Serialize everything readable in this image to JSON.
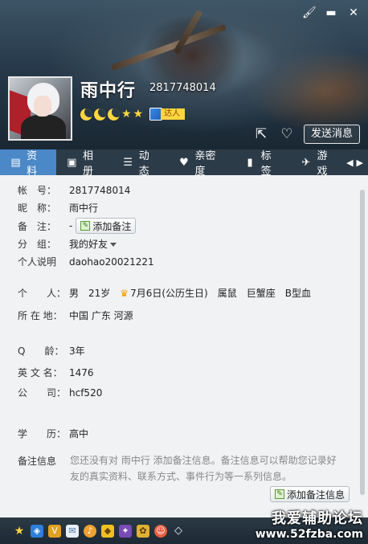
{
  "window": {
    "controls": {
      "skin": "brush-icon",
      "minimize": "minimize-icon",
      "close": "close-icon"
    }
  },
  "header": {
    "nickname": "雨中行",
    "qq_number": "2817748014",
    "level_icons": {
      "moons": 3,
      "stars": 2
    },
    "talent_badge": "达人",
    "send_message_label": "发送消息"
  },
  "tabs": [
    {
      "label": "资料",
      "icon": "profile-card-icon",
      "active": true
    },
    {
      "label": "相册",
      "icon": "photo-album-icon",
      "active": false
    },
    {
      "label": "动态",
      "icon": "feed-list-icon",
      "active": false
    },
    {
      "label": "亲密度",
      "icon": "heart-icon",
      "active": false
    },
    {
      "label": "标签",
      "icon": "bookmark-icon",
      "active": false
    },
    {
      "label": "游戏",
      "icon": "game-icon",
      "active": false
    }
  ],
  "profile": {
    "account_label": "帐　号：",
    "account_value": "2817748014",
    "nickname_label": "昵　称：",
    "nickname_value": "雨中行",
    "remark_label": "备　注：",
    "remark_value": "-",
    "add_remark_label": "添加备注",
    "group_label": "分　组：",
    "group_value": "我的好友",
    "bio_label": "个人说明",
    "bio_value": "daohao20021221",
    "personal_label": "个　　人：",
    "gender": "男",
    "age": "21岁",
    "birthday": "7月6日(公历生日)",
    "zodiac": "属鼠",
    "constellation": "巨蟹座",
    "blood_type": "B型血",
    "location_label": "所 在 地：",
    "location_value": "中国 广东 河源",
    "qage_label": "Q　　龄：",
    "qage_value": "3年",
    "english_name_label": "英 文 名：",
    "english_name_value": "1476",
    "company_label": "公　　司：",
    "company_value": "hcf520",
    "education_label": "学　　历：",
    "education_value": "高中",
    "note_info_label": "备注信息",
    "note_info_text": "您还没有对 雨中行 添加备注信息。备注信息可以帮助您记录好友的真实资料、联系方式、事件行为等一系列信息。",
    "add_note_label": "添加备注信息"
  },
  "bottom_icons": [
    "star-icon",
    "shield-icon",
    "vip-icon",
    "mail-icon",
    "music-icon",
    "security-icon",
    "wizard-icon",
    "pet-icon",
    "avatar-face-icon",
    "diamond-icon"
  ],
  "watermark": {
    "line1": "我爱辅助论坛",
    "line2": "www.52fzba.com"
  }
}
